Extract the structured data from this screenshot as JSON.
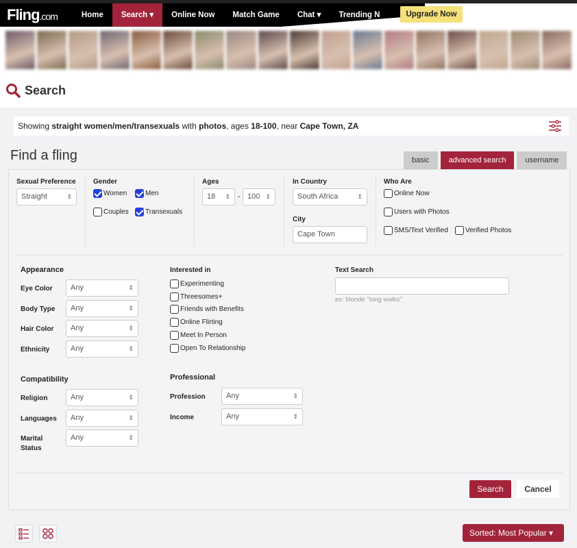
{
  "nav": {
    "logo": "Fling",
    "logo_suffix": ".com",
    "items": [
      {
        "label": "Home"
      },
      {
        "label": "Search ▾"
      },
      {
        "label": "Online Now"
      },
      {
        "label": "Match Game"
      },
      {
        "label": "Chat ▾"
      },
      {
        "label": "Trending N"
      }
    ],
    "upgrade": "Upgrade Now",
    "accent": "#a3243a"
  },
  "photos": [
    "#6b5a66",
    "#7a6b4e",
    "#b49a86",
    "#6e6770",
    "#8a5a3c",
    "#6a4a3a",
    "#8a8a6a",
    "#9a8680",
    "#5a4a4a",
    "#4a3a32",
    "#c0a090",
    "#6a7a90",
    "#b07a80",
    "#907060",
    "#6a4a44",
    "#c0a890",
    "#9a8a70",
    "#8a6a60"
  ],
  "search": {
    "title": "Search",
    "icon": "search-icon"
  },
  "summary": {
    "prefix": "Showing ",
    "who": "straight women/men/transexuals",
    "with": " with ",
    "photos": "photos",
    "ages_prefix": ", ages ",
    "ages": "18-100",
    "near_prefix": ", near ",
    "location": "Cape Town, ZA"
  },
  "find": {
    "title": "Find a fling",
    "tabs": [
      {
        "label": "basic"
      },
      {
        "label": "advanced search"
      },
      {
        "label": "username"
      }
    ]
  },
  "form": {
    "sexual_preference": {
      "label": "Sexual Preference",
      "value": "Straight"
    },
    "gender": {
      "label": "Gender",
      "women": "Women",
      "men": "Men",
      "couples": "Couples",
      "transexuals": "Transexuals"
    },
    "ages": {
      "label": "Ages",
      "min": "18",
      "sep": "-",
      "max": "100"
    },
    "country": {
      "label": "In Country",
      "value": "South Africa"
    },
    "city": {
      "label": "City",
      "value": "Cape Town"
    },
    "who_are": {
      "label": "Who Are",
      "online": "Online Now",
      "photos": "Users with Photos",
      "sms": "SMS/Text Verified",
      "verified": "Verified Photos"
    },
    "appearance": {
      "title": "Appearance",
      "fields": [
        {
          "label": "Eye Color",
          "value": "Any"
        },
        {
          "label": "Body Type",
          "value": "Any"
        },
        {
          "label": "Hair Color",
          "value": "Any"
        },
        {
          "label": "Ethnicity",
          "value": "Any"
        }
      ]
    },
    "interested": {
      "title": "Interested in",
      "items": [
        "Experimenting",
        "Threesomes+",
        "Friends with Benefits",
        "Online Flirting",
        "Meet In Person",
        "Open To Relationship"
      ]
    },
    "text_search": {
      "label": "Text Search",
      "value": "",
      "hint": "ex: blonde \"long walks\""
    },
    "compatibility": {
      "title": "Compatibility",
      "fields": [
        {
          "label": "Religion",
          "value": "Any"
        },
        {
          "label": "Languages",
          "value": "Any"
        },
        {
          "label": "Marital Status",
          "value": "Any"
        }
      ]
    },
    "professional": {
      "title": "Professional",
      "fields": [
        {
          "label": "Profession",
          "value": "Any"
        },
        {
          "label": "Income",
          "value": "Any"
        }
      ]
    },
    "search_btn": "Search",
    "cancel_btn": "Cancel"
  },
  "footer": {
    "sorted": "Sorted: Most Popular ▾"
  }
}
